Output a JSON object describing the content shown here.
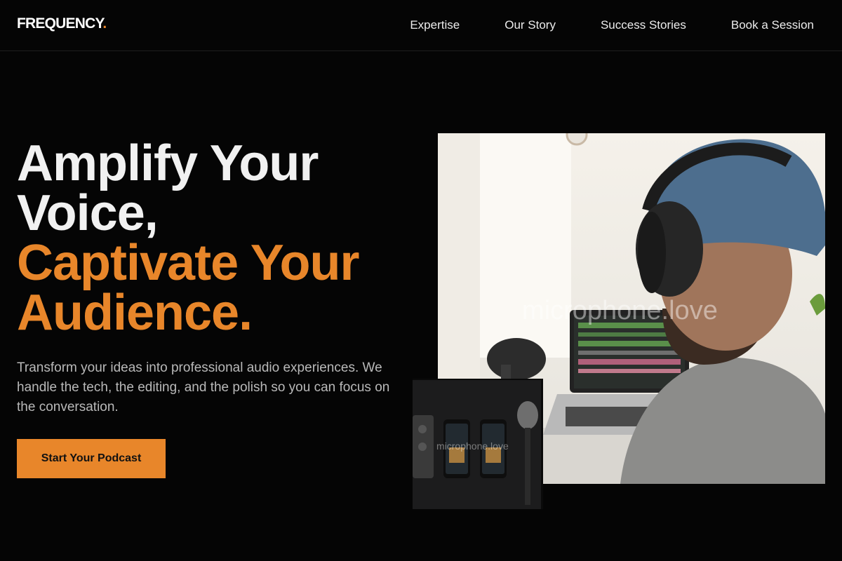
{
  "brand": {
    "name": "FREQUENCY",
    "dot": "."
  },
  "nav": {
    "items": [
      {
        "label": "Expertise"
      },
      {
        "label": "Our Story"
      },
      {
        "label": "Success Stories"
      },
      {
        "label": "Book a Session"
      }
    ]
  },
  "hero": {
    "headline_line1": "Amplify Your",
    "headline_line2": "Voice,",
    "headline_line3": "Captivate Your",
    "headline_line4": "Audience.",
    "subtitle": "Transform your ideas into professional audio experiences. We handle the tech, the editing, and the polish so you can focus on the conversation.",
    "cta_label": "Start Your Podcast"
  },
  "images": {
    "main_watermark": "microphone.love",
    "small_watermark": "microphone.love"
  },
  "colors": {
    "accent": "#e8862a",
    "background": "#050505",
    "text": "#f1f1f1",
    "muted_text": "#b9b9b9"
  }
}
